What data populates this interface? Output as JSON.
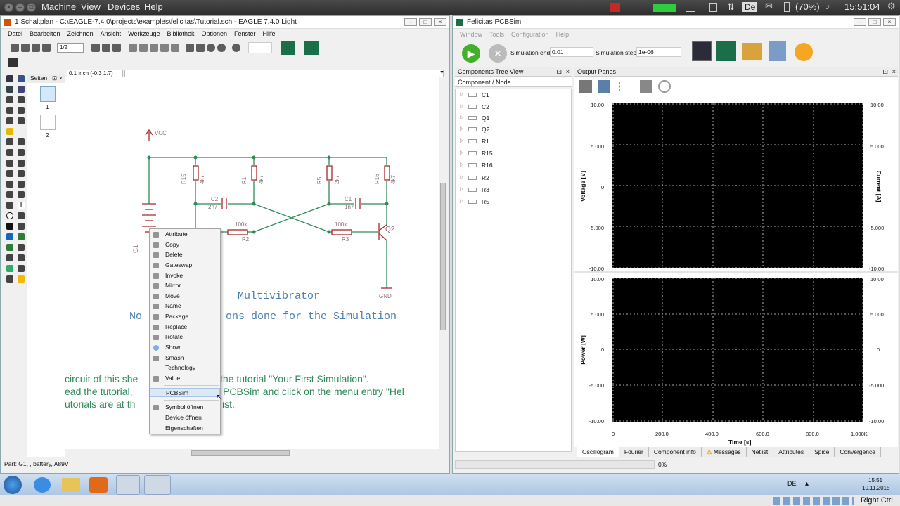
{
  "host": {
    "menu": [
      "Machine",
      "View",
      "Devices",
      "Help"
    ],
    "lang": "De",
    "battery": "(70%)",
    "time": "15:51:04"
  },
  "eagle": {
    "title": "1 Schaltplan - C:\\EAGLE-7.4.0\\projects\\examples\\felicitas\\Tutorial.sch - EAGLE 7.4.0 Light",
    "menu": [
      "Datei",
      "Bearbeiten",
      "Zeichnen",
      "Ansicht",
      "Werkzeuge",
      "Bibliothek",
      "Optionen",
      "Fenster",
      "Hilfe"
    ],
    "zoom_select": "1/2",
    "pages_label": "Seiten",
    "page_numbers": [
      "1",
      "2"
    ],
    "coord_readout": "0.1 inch (-0.3 1.7)",
    "status": "Part: G1, , battery, A89V",
    "schematic": {
      "vcc": "VCC",
      "gnd": "GND",
      "labels": [
        "R15",
        "R1",
        "R5",
        "R16",
        "4k7",
        "2k7",
        "C2",
        "C1",
        "2n7",
        "1n7",
        "100k",
        "100k",
        "R2",
        "R3",
        "Q2",
        "G1"
      ],
      "title": "Multivibrator",
      "notice_left": "No",
      "notice_right": "ons done for the Simulation",
      "para1_left": "circuit of this she",
      "para1_right": "the tutorial \"Your First Simulation\".",
      "para2_left": "ead the tutorial,",
      "para2_right": "PCBSim and click on the menu entry \"Hel",
      "para3_left": "utorials are at th",
      "para3_right": "ist."
    },
    "context_menu": [
      "Attribute",
      "Copy",
      "Delete",
      "Gateswap",
      "Invoke",
      "Mirror",
      "Move",
      "Name",
      "Package",
      "Replace",
      "Rotate",
      "Show",
      "Smash",
      "Technology",
      "Value",
      "PCBSim",
      "Symbol öffnen",
      "Device öffnen",
      "Eigenschaften"
    ]
  },
  "pcbsim": {
    "title": "Felicitas PCBSim",
    "menu": [
      "Window",
      "Tools",
      "Configuration",
      "Help"
    ],
    "sim_end_label": "Simulation end:",
    "sim_end_value": "0.01",
    "sim_step_label": "Simulation step:",
    "sim_step_value": "1e-06",
    "tree_title": "Components Tree View",
    "tree_header": "Component / Node",
    "tree_items": [
      "C1",
      "C2",
      "Q1",
      "Q2",
      "R1",
      "R15",
      "R16",
      "R2",
      "R3",
      "R5"
    ],
    "output_title": "Output Panes",
    "top_plot": {
      "ylabel": "Voltage [V]",
      "ylabel_right": "Current [A]",
      "yticks": [
        "10.00",
        "5.000",
        "0",
        "-5.000",
        "-10.00"
      ]
    },
    "bottom_plot": {
      "ylabel": "Power [W]",
      "yticks": [
        "10.00",
        "5.000",
        "0",
        "-5.000",
        "-10.00"
      ],
      "xticks": [
        "0",
        "200.0",
        "400.0",
        "600.0",
        "800.0",
        "1.000K"
      ],
      "xlabel": "Time [s]"
    },
    "tabs": [
      "Oscillogram",
      "Fourier",
      "Component info",
      "Messages",
      "Netlist",
      "Attributes",
      "Spice",
      "Convergence"
    ],
    "progress": "0%"
  },
  "taskbar": {
    "lang": "DE",
    "time": "15:51",
    "date": "10.11.2015",
    "right_ctrl": "Right Ctrl"
  }
}
